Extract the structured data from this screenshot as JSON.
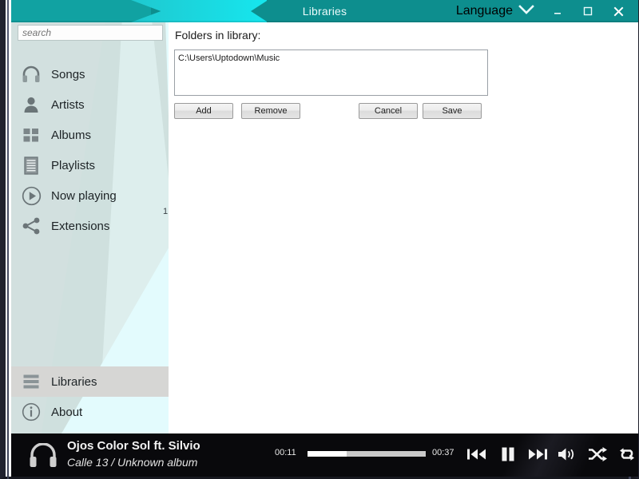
{
  "window": {
    "title": "Libraries",
    "language_label": "Language",
    "language_chevron_icon": "chevron-down-icon",
    "minimize_icon": "minimize-icon",
    "maximize_icon": "maximize-icon",
    "close_icon": "close-icon",
    "accent_color": "#0d8e8e",
    "accent_bright_color": "#16e6ee"
  },
  "sidebar": {
    "search": {
      "value": "",
      "placeholder": "search"
    },
    "items": [
      {
        "label": "Songs",
        "icon": "headphones-icon",
        "selected": false
      },
      {
        "label": "Artists",
        "icon": "person-icon",
        "selected": false
      },
      {
        "label": "Albums",
        "icon": "grid-icon",
        "selected": false
      },
      {
        "label": "Playlists",
        "icon": "list-lines-icon",
        "selected": false
      },
      {
        "label": "Now playing",
        "icon": "play-circle-icon",
        "selected": false
      },
      {
        "label": "Extensions",
        "icon": "share-icon",
        "selected": false
      }
    ],
    "now_playing_count": "1",
    "bottom_items": [
      {
        "label": "Libraries",
        "icon": "library-stack-icon",
        "selected": true
      },
      {
        "label": "About",
        "icon": "info-circle-icon",
        "selected": false
      }
    ]
  },
  "main": {
    "heading": "Folders in library:",
    "folders": [
      "C:\\Users\\Uptodown\\Music"
    ],
    "buttons": {
      "add": "Add",
      "remove": "Remove",
      "cancel": "Cancel",
      "save": "Save"
    }
  },
  "player": {
    "track_title": "Ojos Color Sol ft. Silvio",
    "track_subtitle": "Calle 13 / Unknown album",
    "time_elapsed": "00:11",
    "time_total": "00:37",
    "progress_percent": 33,
    "headphones_icon": "headphones-icon",
    "controls": [
      {
        "name": "previous-track",
        "icon": "previous-icon"
      },
      {
        "name": "pause",
        "icon": "pause-icon"
      },
      {
        "name": "next-track",
        "icon": "next-icon"
      },
      {
        "name": "volume",
        "icon": "volume-icon"
      },
      {
        "name": "shuffle",
        "icon": "shuffle-icon"
      },
      {
        "name": "repeat",
        "icon": "repeat-icon"
      }
    ]
  }
}
